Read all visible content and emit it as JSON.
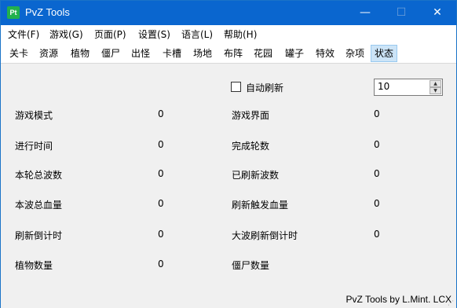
{
  "window": {
    "title": "PvZ Tools",
    "icon_text": "Pt",
    "min_glyph": "—",
    "max_glyph": "☐",
    "close_glyph": "✕"
  },
  "menu": [
    "文件(F)",
    "游戏(G)",
    "页面(P)",
    "设置(S)",
    "语言(L)",
    "帮助(H)"
  ],
  "tabs": [
    "关卡",
    "资源",
    "植物",
    "僵尸",
    "出怪",
    "卡槽",
    "场地",
    "布阵",
    "花园",
    "罐子",
    "特效",
    "杂项",
    "状态"
  ],
  "active_tab": "状态",
  "controls": {
    "auto_refresh_label": "自动刷新",
    "auto_refresh_checked": false,
    "interval_value": "10"
  },
  "fields": {
    "game_mode": {
      "label": "游戏模式",
      "value": "0"
    },
    "game_ui": {
      "label": "游戏界面",
      "value": "0"
    },
    "running_time": {
      "label": "进行时间",
      "value": "0"
    },
    "completed_rounds": {
      "label": "完成轮数",
      "value": "0"
    },
    "total_waves": {
      "label": "本轮总波数",
      "value": "0"
    },
    "refreshed_waves": {
      "label": "已刷新波数",
      "value": "0"
    },
    "wave_total_hp": {
      "label": "本波总血量",
      "value": "0"
    },
    "refresh_trigger_hp": {
      "label": "刷新触发血量",
      "value": "0"
    },
    "refresh_countdown": {
      "label": "刷新倒计时",
      "value": "0"
    },
    "big_wave_countdown": {
      "label": "大波刷新倒计时",
      "value": "0"
    },
    "plant_count": {
      "label": "植物数量",
      "value": "0"
    },
    "zombie_count": {
      "label": "僵尸数量",
      "value": ""
    }
  },
  "status_bar": "PvZ Tools by L.Mint. LCX",
  "colors": {
    "titlebar": "#0a66cf",
    "active_tab_bg": "#cce4f7",
    "app_icon": "#22b14c"
  }
}
